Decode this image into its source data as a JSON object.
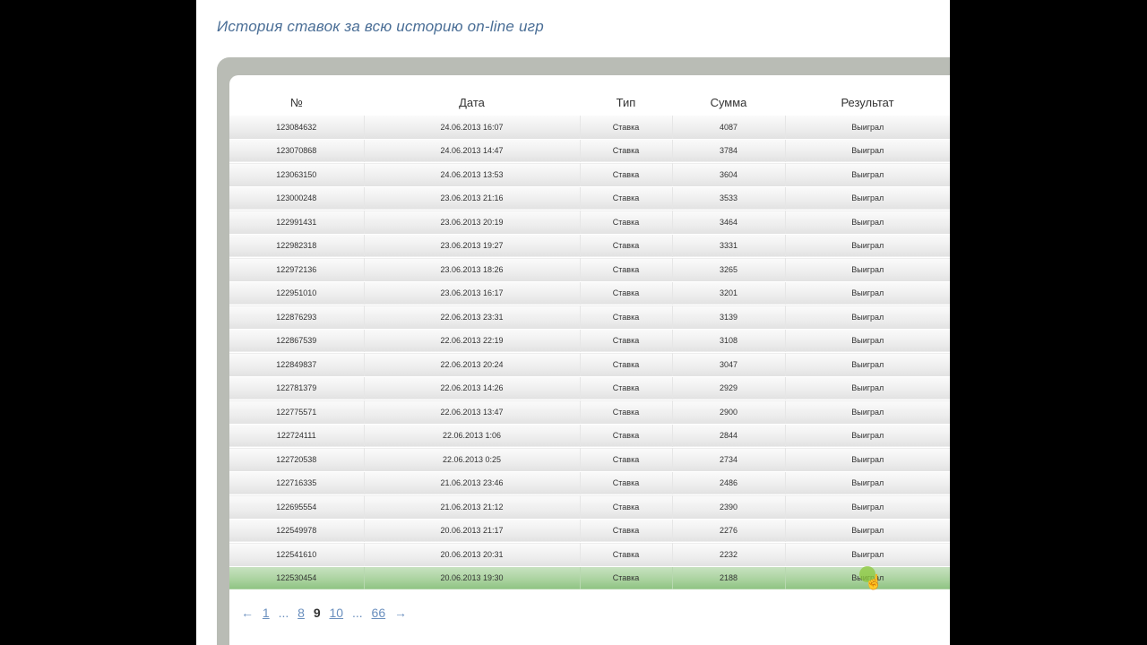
{
  "page": {
    "title": "История ставок за всю историю on-line игр"
  },
  "table": {
    "headers": [
      "№",
      "Дата",
      "Тип",
      "Сумма",
      "Результат"
    ],
    "rows": [
      [
        "123084632",
        "24.06.2013 16:07",
        "Ставка",
        "4087",
        "Выиграл"
      ],
      [
        "123070868",
        "24.06.2013 14:47",
        "Ставка",
        "3784",
        "Выиграл"
      ],
      [
        "123063150",
        "24.06.2013 13:53",
        "Ставка",
        "3604",
        "Выиграл"
      ],
      [
        "123000248",
        "23.06.2013 21:16",
        "Ставка",
        "3533",
        "Выиграл"
      ],
      [
        "122991431",
        "23.06.2013 20:19",
        "Ставка",
        "3464",
        "Выиграл"
      ],
      [
        "122982318",
        "23.06.2013 19:27",
        "Ставка",
        "3331",
        "Выиграл"
      ],
      [
        "122972136",
        "23.06.2013 18:26",
        "Ставка",
        "3265",
        "Выиграл"
      ],
      [
        "122951010",
        "23.06.2013 16:17",
        "Ставка",
        "3201",
        "Выиграл"
      ],
      [
        "122876293",
        "22.06.2013 23:31",
        "Ставка",
        "3139",
        "Выиграл"
      ],
      [
        "122867539",
        "22.06.2013 22:19",
        "Ставка",
        "3108",
        "Выиграл"
      ],
      [
        "122849837",
        "22.06.2013 20:24",
        "Ставка",
        "3047",
        "Выиграл"
      ],
      [
        "122781379",
        "22.06.2013 14:26",
        "Ставка",
        "2929",
        "Выиграл"
      ],
      [
        "122775571",
        "22.06.2013 13:47",
        "Ставка",
        "2900",
        "Выиграл"
      ],
      [
        "122724111",
        "22.06.2013 1:06",
        "Ставка",
        "2844",
        "Выиграл"
      ],
      [
        "122720538",
        "22.06.2013 0:25",
        "Ставка",
        "2734",
        "Выиграл"
      ],
      [
        "122716335",
        "21.06.2013 23:46",
        "Ставка",
        "2486",
        "Выиграл"
      ],
      [
        "122695554",
        "21.06.2013 21:12",
        "Ставка",
        "2390",
        "Выиграл"
      ],
      [
        "122549978",
        "20.06.2013 21:17",
        "Ставка",
        "2276",
        "Выиграл"
      ],
      [
        "122541610",
        "20.06.2013 20:31",
        "Ставка",
        "2232",
        "Выиграл"
      ],
      [
        "122530454",
        "20.06.2013 19:30",
        "Ставка",
        "2188",
        "Выиграл"
      ]
    ],
    "highlighted_row": 19
  },
  "pager": {
    "prev": "←",
    "first": "1",
    "dots1": "...",
    "p8": "8",
    "current": "9",
    "p10": "10",
    "dots2": "...",
    "last": "66",
    "next": "→"
  },
  "colors": {
    "title": "#4a6e96",
    "frame": "#b9bcb5",
    "highlight": "#a9d29e",
    "link": "#6a8fbe"
  }
}
